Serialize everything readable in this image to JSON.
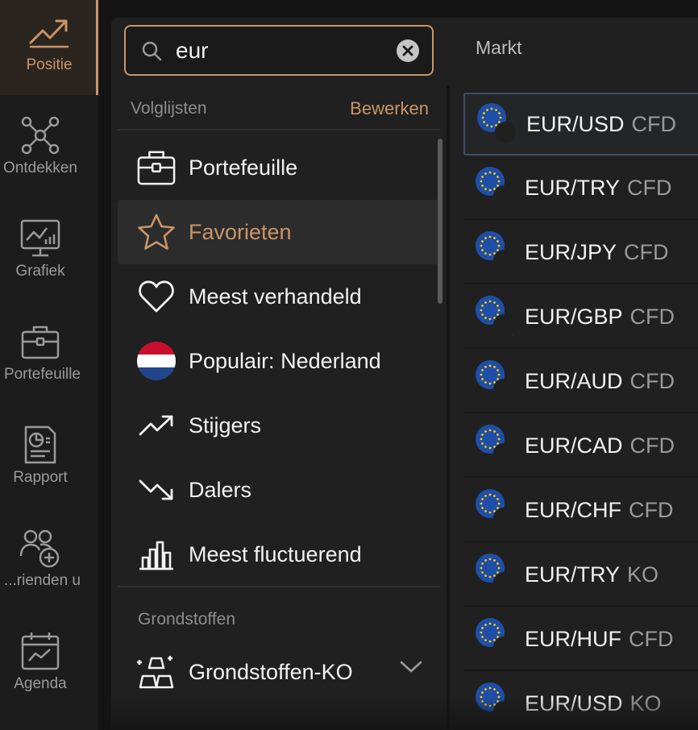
{
  "rail": [
    {
      "label": "Positie",
      "icon": "trend-up-icon",
      "active": true
    },
    {
      "label": "Ontdekken",
      "icon": "network-icon"
    },
    {
      "label": "Grafiek",
      "icon": "chart-monitor-icon"
    },
    {
      "label": "Portefeuille",
      "icon": "briefcase-icon"
    },
    {
      "label": "Rapport",
      "icon": "report-icon"
    },
    {
      "label": "rienden u...",
      "icon": "add-friend-icon"
    },
    {
      "label": "Agenda",
      "icon": "calendar-icon"
    }
  ],
  "search": {
    "value": "eur",
    "icon": "search-icon",
    "clear_icon": "clear-icon"
  },
  "header": {
    "markt_tab": "Markt"
  },
  "watchlists": {
    "title": "Volglijsten",
    "edit": "Bewerken",
    "items": [
      {
        "label": "Portefeuille",
        "icon": "briefcase-icon"
      },
      {
        "label": "Favorieten",
        "icon": "star-icon",
        "selected": true
      },
      {
        "label": "Meest verhandeld",
        "icon": "heart-icon"
      },
      {
        "label": "Populair: Nederland",
        "icon": "netherlands-flag-icon"
      },
      {
        "label": "Stijgers",
        "icon": "trend-up-icon"
      },
      {
        "label": "Dalers",
        "icon": "trend-down-icon"
      },
      {
        "label": "Meest fluctuerend",
        "icon": "bar-chart-icon"
      }
    ]
  },
  "commodities": {
    "title": "Grondstoffen",
    "items": [
      {
        "label": "Grondstoffen-KO",
        "icon": "gold-bars-icon",
        "chevron": "chevron-down-icon"
      }
    ]
  },
  "markets": [
    {
      "symbol": "EUR/USD",
      "type": "CFD",
      "quote_flag": "us",
      "selected": true
    },
    {
      "symbol": "EUR/TRY",
      "type": "CFD",
      "quote_flag": "tr"
    },
    {
      "symbol": "EUR/JPY",
      "type": "CFD",
      "quote_flag": "jp"
    },
    {
      "symbol": "EUR/GBP",
      "type": "CFD",
      "quote_flag": "gb"
    },
    {
      "symbol": "EUR/AUD",
      "type": "CFD",
      "quote_flag": "au"
    },
    {
      "symbol": "EUR/CAD",
      "type": "CFD",
      "quote_flag": "ca"
    },
    {
      "symbol": "EUR/CHF",
      "type": "CFD",
      "quote_flag": "ch"
    },
    {
      "symbol": "EUR/TRY",
      "type": "KO",
      "quote_flag": "tr"
    },
    {
      "symbol": "EUR/HUF",
      "type": "CFD",
      "quote_flag": "hu"
    },
    {
      "symbol": "EUR/USD",
      "type": "KO",
      "quote_flag": "us"
    }
  ],
  "colors": {
    "accent": "#c99566",
    "background": "#202020",
    "rail": "#1c1c1c"
  }
}
